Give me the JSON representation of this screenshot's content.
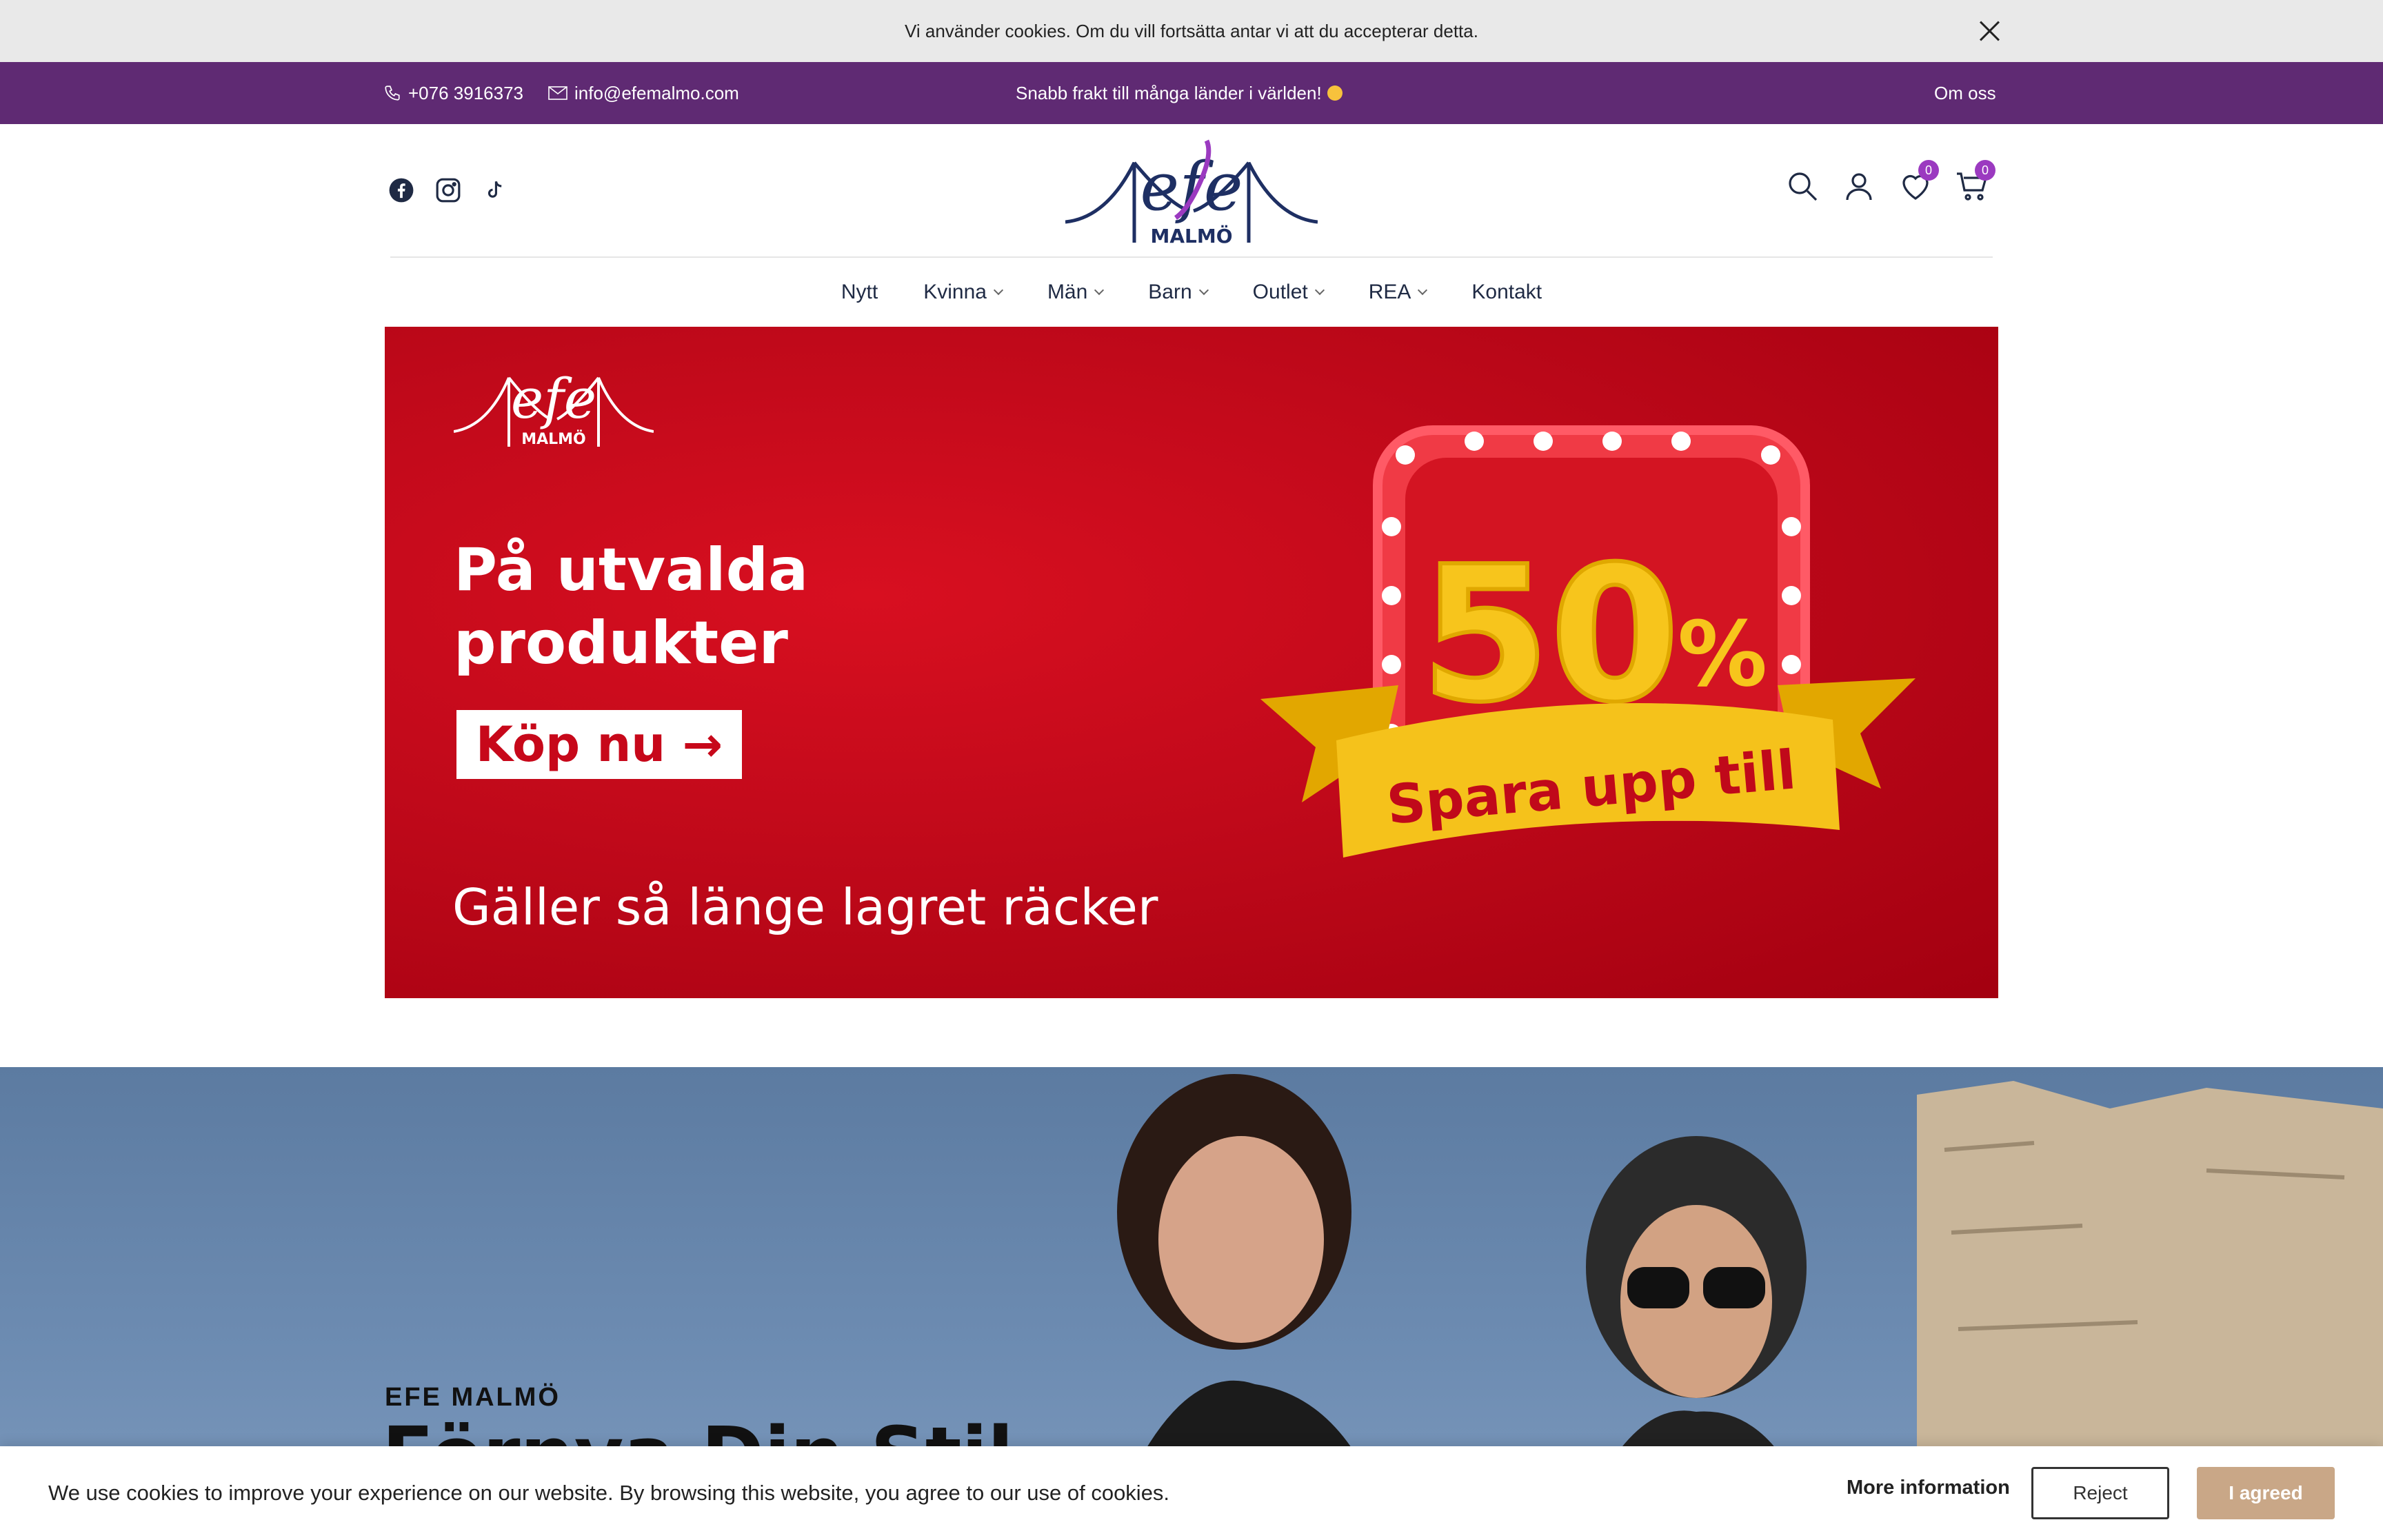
{
  "cookie_notice": {
    "text": "Vi använder cookies. Om du vill fortsätta antar vi att du accepterar detta."
  },
  "topbar": {
    "phone": "+076 3916373",
    "email": "info@efemalmo.com",
    "promo": "Snabb frakt till många länder i världen!",
    "about": "Om oss"
  },
  "logo": {
    "script": "efe",
    "city": "MALMÖ"
  },
  "header": {
    "wishlist_count": "0",
    "cart_count": "0"
  },
  "nav": {
    "items": [
      {
        "label": "Nytt",
        "has_dropdown": false
      },
      {
        "label": "Kvinna",
        "has_dropdown": true
      },
      {
        "label": "Män",
        "has_dropdown": true
      },
      {
        "label": "Barn",
        "has_dropdown": true
      },
      {
        "label": "Outlet",
        "has_dropdown": true
      },
      {
        "label": "REA",
        "has_dropdown": true
      },
      {
        "label": "Kontakt",
        "has_dropdown": false
      }
    ]
  },
  "banner": {
    "headline_line1": "På utvalda",
    "headline_line2": "produkter",
    "cta": "Köp nu →",
    "disclaimer": "Gäller så länge lagret räcker",
    "discount": "50",
    "percent": "%",
    "ribbon": "Spara upp till"
  },
  "hero2": {
    "eyebrow": "EFE MALMÖ",
    "title": "Förnya Din Stil"
  },
  "cookie_bar": {
    "message": "We use cookies to improve your experience on our website. By browsing this website, you agree to our use of cookies.",
    "more_info": "More information",
    "reject": "Reject",
    "agree": "I agreed"
  },
  "colors": {
    "topbar": "#5f2a73",
    "banner_red": "#c0091a",
    "accent_badge": "#9b3ac0",
    "agree_button": "#c9a787",
    "ribbon_yellow": "#f5c21b"
  }
}
